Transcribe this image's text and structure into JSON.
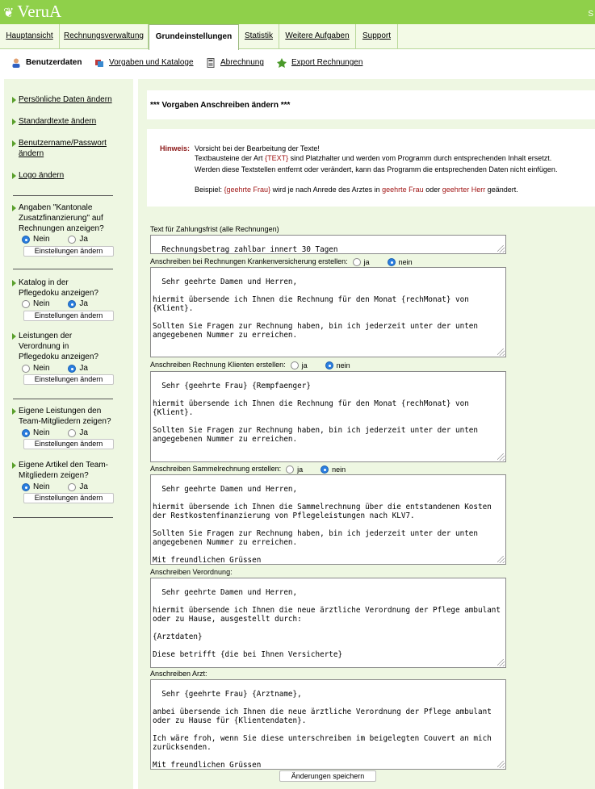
{
  "app": {
    "logo_text": "VeruA",
    "topright": "S"
  },
  "tabs": [
    {
      "label": "Hauptansicht"
    },
    {
      "label": "Rechnungsverwaltung"
    },
    {
      "label": "Grundeinstellungen"
    },
    {
      "label": "Statistik"
    },
    {
      "label": "Weitere Aufgaben"
    },
    {
      "label": "Support"
    }
  ],
  "subnav": [
    {
      "label": "Benutzerdaten"
    },
    {
      "label": "Vorgaben und Kataloge"
    },
    {
      "label": "Abrechnung"
    },
    {
      "label": "Export Rechnungen"
    }
  ],
  "sidebar": {
    "links": [
      "Persönliche Daten ändern",
      "Standardtexte ändern",
      "Benutzername/Passwort ändern",
      "Logo ändern"
    ],
    "questions": [
      {
        "text": "Angaben \"Kantonale Zusatzfinanzierung\" auf Rechnungen anzeigen?",
        "opt1": "Nein",
        "opt2": "Ja",
        "selected": "Nein",
        "button": "Einstellungen ändern"
      },
      {
        "text": "Katalog in der Pflegedoku anzeigen?",
        "opt1": "Nein",
        "opt2": "Ja",
        "selected": "Ja",
        "button": "Einstellungen ändern"
      },
      {
        "text": "Leistungen der Verordnung in Pflegedoku anzeigen?",
        "opt1": "Nein",
        "opt2": "Ja",
        "selected": "Ja",
        "button": "Einstellungen ändern"
      },
      {
        "text": "Eigene Leistungen den Team-Mitgliedern zeigen?",
        "opt1": "Nein",
        "opt2": "Ja",
        "selected": "Nein",
        "button": "Einstellungen ändern"
      },
      {
        "text": "Eigene Artikel den Team-Mitgliedern zeigen?",
        "opt1": "Nein",
        "opt2": "Ja",
        "selected": "Nein",
        "button": "Einstellungen ändern"
      }
    ]
  },
  "main": {
    "title": "*** Vorgaben Anschreiben ändern ***",
    "hint": {
      "label": "Hinweis:",
      "line1": "Vorsicht bei der Bearbeitung der Texte!",
      "line2a": "Textbausteine der Art ",
      "line2b": "{TEXT}",
      "line2c": " sind Platzhalter und werden vom Programm durch entsprechenden Inhalt ersetzt.",
      "line3": "Werden diese Textstellen entfernt oder verändert, kann das Programm die entsprechenden Daten nicht einfügen.",
      "ex_a": "Beispiel: ",
      "ex_b": "{geehrte Frau}",
      "ex_c": " wird je nach Anrede des Arztes in ",
      "ex_d": "geehrte Frau",
      "ex_e": " oder ",
      "ex_f": "geehrter Herr",
      "ex_g": " geändert."
    },
    "fields": [
      {
        "label": "Text für Zahlungsfrist (alle Rechnungen)",
        "value": "Rechnungsbetrag zahlbar innert 30 Tagen"
      },
      {
        "label": "Anschreiben bei Rechnungen Krankenversicherung erstellen:",
        "opt1": "ja",
        "opt2": "nein",
        "selected": "nein",
        "value": "Sehr geehrte Damen und Herren,\n\nhiermit übersende ich Ihnen die Rechnung für den Monat {rechMonat} von {Klient}.\n\nSollten Sie Fragen zur Rechnung haben, bin ich jederzeit unter der unten angegebenen Nummer zu erreichen.\n\n\nMit freundlichen Grüssen"
      },
      {
        "label": "Anschreiben Rechnung Klienten erstellen:",
        "opt1": "ja",
        "opt2": "nein",
        "selected": "nein",
        "value": "Sehr {geehrte Frau} {Rempfaenger}\n\nhiermit übersende ich Ihnen die Rechnung für den Monat {rechMonat} von {Klient}.\n\nSollten Sie Fragen zur Rechnung haben, bin ich jederzeit unter der unten angegebenen Nummer zu erreichen.\n\n\nMit freundlichen Grüssen"
      },
      {
        "label": "Anschreiben Sammelrechnung erstellen:",
        "opt1": "ja",
        "opt2": "nein",
        "selected": "nein",
        "value": "Sehr geehrte Damen und Herren,\n\nhiermit übersende ich Ihnen die Sammelrechnung über die entstandenen Kosten der Restkostenfinanzierung von Pflegeleistungen nach KLV7.\n\nSollten Sie Fragen zur Rechnung haben, bin ich jederzeit unter der unten angegebenen Nummer zu erreichen.\n\nMit freundlichen Grüssen"
      },
      {
        "label": "Anschreiben Verordnung:",
        "value": "Sehr geehrte Damen und Herren,\n\nhiermit übersende ich Ihnen die neue ärztliche Verordnung der Pflege ambulant oder zu Hause, ausgestellt durch:\n\n{Arztdaten}\n\nDiese betrifft {die bei Ihnen Versicherte}\n\n{Klientendaten}"
      },
      {
        "label": "Anschreiben Arzt:",
        "value": "Sehr {geehrte Frau} {Arztname},\n\nanbei übersende ich Ihnen die neue ärztliche Verordnung der Pflege ambulant oder zu Hause für {Klientendaten}.\n\nIch wäre froh, wenn Sie diese unterschreiben im beigelegten Couvert an mich zurücksenden.\n\nMit freundlichen Grüssen"
      }
    ],
    "save_label": "Änderungen speichern"
  }
}
